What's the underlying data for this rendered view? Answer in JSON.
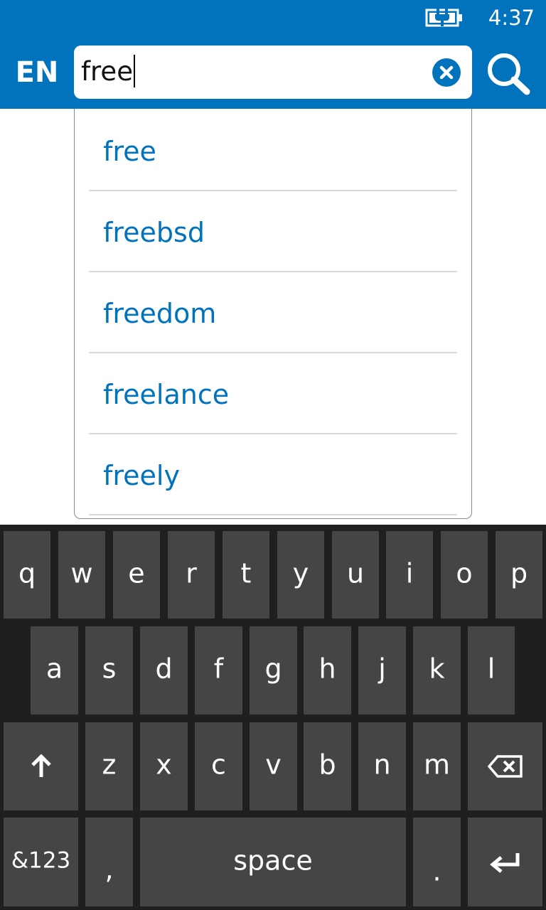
{
  "status_bar": {
    "time": "4:37",
    "battery_icon": "battery-charging-icon"
  },
  "header": {
    "language": "EN",
    "search": {
      "value": "free",
      "clear_icon": "clear-icon",
      "search_icon": "search-icon"
    }
  },
  "suggestions": [
    {
      "label": "free"
    },
    {
      "label": "freebsd"
    },
    {
      "label": "freedom"
    },
    {
      "label": "freelance"
    },
    {
      "label": "freely"
    }
  ],
  "keyboard": {
    "row1": [
      "q",
      "w",
      "e",
      "r",
      "t",
      "y",
      "u",
      "i",
      "o",
      "p"
    ],
    "row2": [
      "a",
      "s",
      "d",
      "f",
      "g",
      "h",
      "j",
      "k",
      "l"
    ],
    "row3": [
      "z",
      "x",
      "c",
      "v",
      "b",
      "n",
      "m"
    ],
    "shift_icon": "shift-arrow-icon",
    "backspace_icon": "backspace-icon",
    "symbols_label": "&123",
    "comma_label": ",",
    "space_label": "space",
    "period_label": ".",
    "enter_icon": "enter-icon"
  },
  "colors": {
    "accent": "#0173bd",
    "keyboard_background": "#1f1f1f",
    "key": "#454545"
  }
}
